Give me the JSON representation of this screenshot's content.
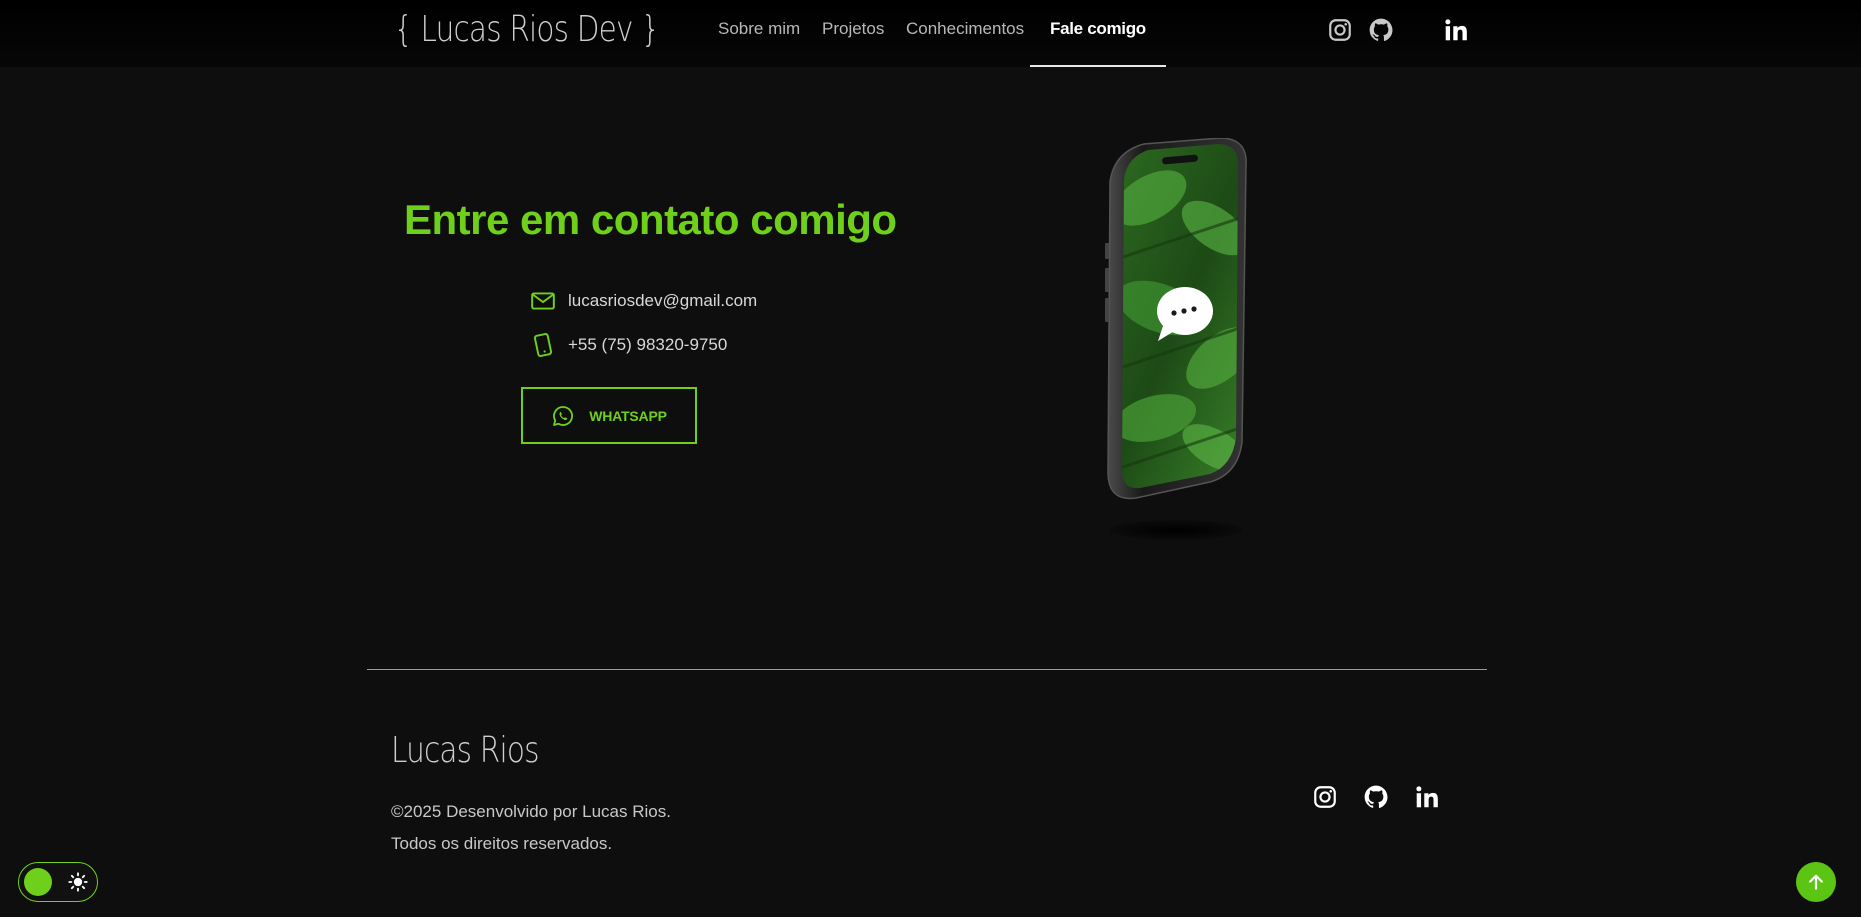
{
  "header": {
    "brand": "{ Lucas Rios Dev }",
    "nav": [
      {
        "label": "Sobre mim"
      },
      {
        "label": "Projetos"
      },
      {
        "label": "Conhecimentos"
      },
      {
        "label": "Fale comigo"
      }
    ],
    "active_nav": "Fale comigo",
    "social_icons": [
      "instagram-icon",
      "github-icon",
      "linkedin-icon"
    ]
  },
  "contact": {
    "title": "Entre em contato comigo",
    "email": "lucasriosdev@gmail.com",
    "phone": "+55 (75) 98320-9750",
    "whatsapp_label": "WHATSAPP",
    "icons": [
      "mail-icon",
      "phone-icon",
      "whatsapp-icon"
    ]
  },
  "illustration": {
    "icon": "chat-bubble-icon",
    "bubble_text": "..."
  },
  "footer": {
    "name": "Lucas Rios",
    "copyright": "©2025 Desenvolvido por Lucas Rios.",
    "rights": "Todos os direitos reservados.",
    "social_icons": [
      "instagram-icon",
      "github-icon",
      "linkedin-icon"
    ]
  },
  "controls": {
    "theme_toggle_icon": "sun-icon",
    "scroll_top_icon": "arrow-up-icon"
  },
  "colors": {
    "accent": "#6fd01c",
    "background": "#0e0e0e",
    "text": "#d6d6d6"
  }
}
